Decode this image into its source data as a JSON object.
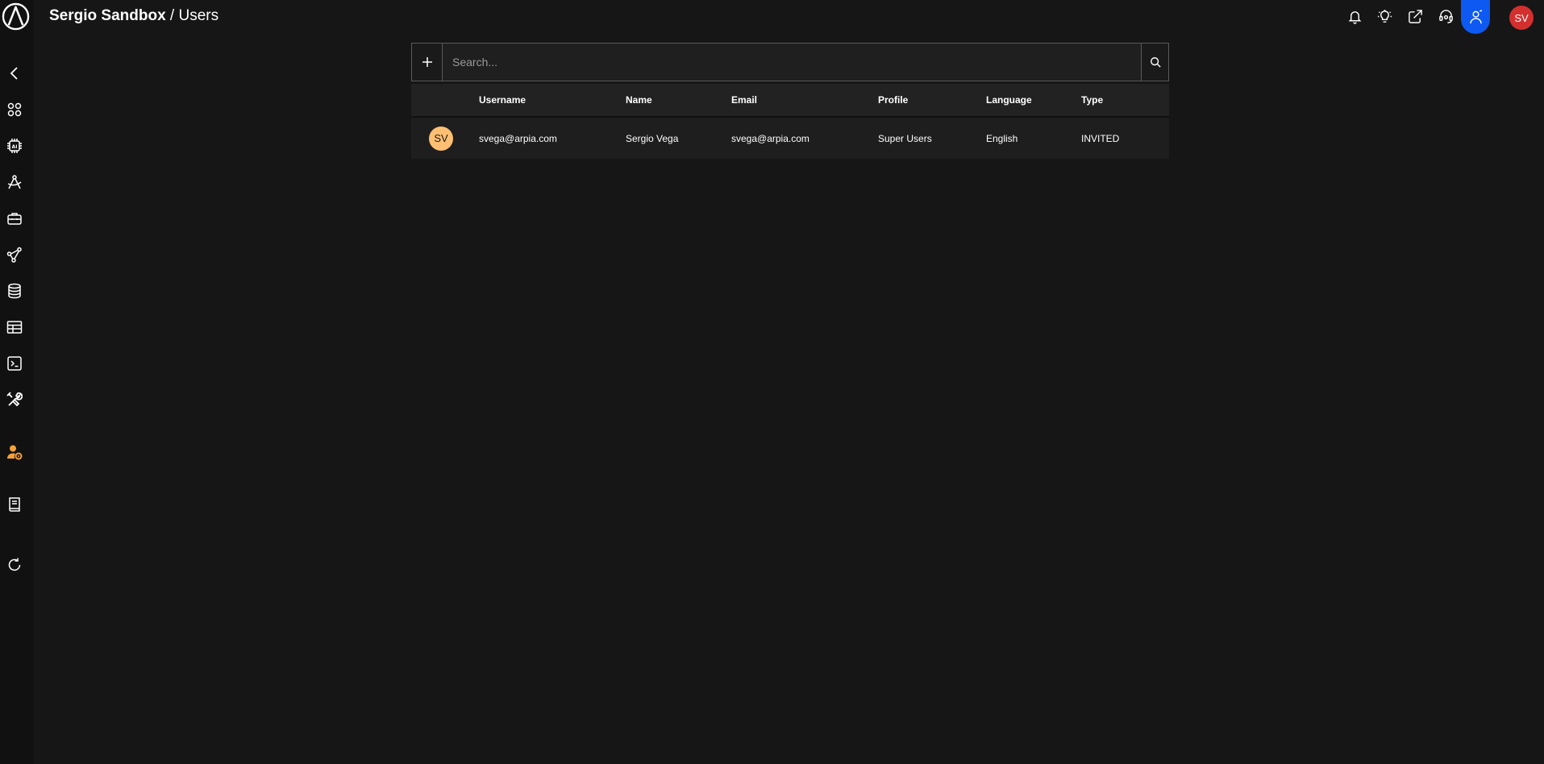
{
  "header": {
    "workspace": "Sergio Sandbox",
    "separator": " / ",
    "page": "Users"
  },
  "user": {
    "initials": "SV",
    "avatar_color": "#d32f2f"
  },
  "accent": "#0d59f2",
  "sidebar": {
    "items": [
      {
        "icon": "chevron-left-icon"
      },
      {
        "icon": "apps-grid-icon"
      },
      {
        "icon": "ai-chip-icon"
      },
      {
        "icon": "compass-tool-icon"
      },
      {
        "icon": "toolbox-icon"
      },
      {
        "icon": "network-nodes-icon"
      },
      {
        "icon": "database-icon"
      },
      {
        "icon": "table-icon"
      },
      {
        "icon": "terminal-icon"
      },
      {
        "icon": "tools-icon"
      },
      {
        "icon": "user-settings-icon",
        "active": true,
        "color": "#f5a13a"
      },
      {
        "icon": "book-icon"
      },
      {
        "icon": "refresh-icon"
      }
    ]
  },
  "topbar_icons": [
    "bell-icon",
    "lightbulb-icon",
    "share-icon",
    "support-headset-icon",
    "users-icon"
  ],
  "search": {
    "placeholder": "Search..."
  },
  "table": {
    "columns": [
      "Username",
      "Name",
      "Email",
      "Profile",
      "Language",
      "Type"
    ],
    "rows": [
      {
        "initials": "SV",
        "avatar_color": "#ffbf73",
        "username": "svega@arpia.com",
        "name": "Sergio Vega",
        "email": "svega@arpia.com",
        "profile": "Super Users",
        "language": "English",
        "type": "INVITED"
      }
    ]
  }
}
